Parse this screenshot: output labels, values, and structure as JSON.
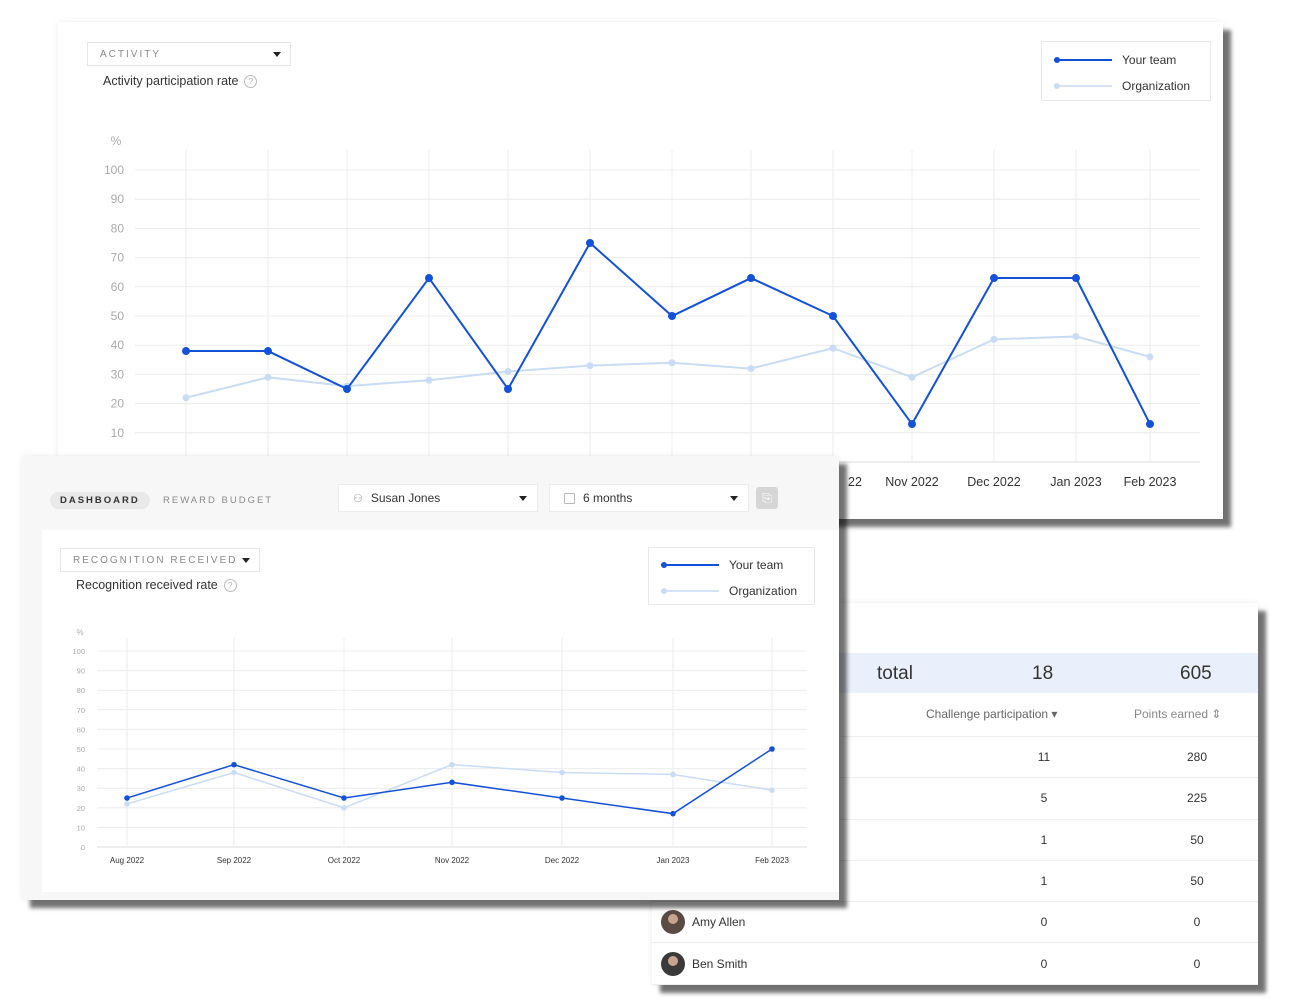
{
  "activity_chart": {
    "dropdown_label": "ACTIVITY",
    "subtitle": "Activity participation rate",
    "help_icon": "?",
    "legend": {
      "team": "Your team",
      "org": "Organization"
    },
    "colors": {
      "team": "#1251d9",
      "org": "#c9dcf5"
    },
    "y_unit": "%",
    "chart_data": {
      "type": "line",
      "y_ticks": [
        "100",
        "90",
        "80",
        "70",
        "60",
        "50",
        "40",
        "30",
        "20",
        "10"
      ],
      "x_labels": [
        "",
        "",
        "",
        "",
        "",
        "",
        "",
        "",
        "Oct 2022",
        "Nov 2022",
        "Dec 2022",
        "Jan 2023",
        "Feb 2023"
      ],
      "x_visible_labels": [
        "22",
        "Nov 2022",
        "Dec 2022",
        "Jan 2023",
        "Feb 2023"
      ],
      "ylim": [
        0,
        100
      ],
      "series": [
        {
          "name": "Your team",
          "values": [
            38,
            38,
            25,
            63,
            25,
            75,
            50,
            63,
            50,
            13,
            63,
            63,
            13
          ]
        },
        {
          "name": "Organization",
          "values": [
            22,
            29,
            26,
            28,
            31,
            33,
            34,
            32,
            39,
            29,
            42,
            43,
            36
          ]
        }
      ]
    }
  },
  "recognition_panel": {
    "tabs": {
      "dashboard": "DASHBOARD",
      "reward_budget": "REWARD BUDGET"
    },
    "person_select": "Susan Jones",
    "period_select": "6 months",
    "dropdown_label": "RECOGNITION RECEIVED",
    "subtitle": "Recognition received rate",
    "help_icon": "?",
    "legend": {
      "team": "Your team",
      "org": "Organization"
    },
    "y_unit": "%",
    "chart_data": {
      "type": "line",
      "y_ticks": [
        "100",
        "90",
        "80",
        "70",
        "60",
        "50",
        "40",
        "30",
        "20",
        "10",
        "0"
      ],
      "categories": [
        "Aug 2022",
        "Sep 2022",
        "Oct 2022",
        "Nov 2022",
        "Dec 2022",
        "Jan 2023",
        "Feb 2023"
      ],
      "ylim": [
        0,
        100
      ],
      "series": [
        {
          "name": "Your team",
          "values": [
            25,
            42,
            25,
            33,
            25,
            17,
            50
          ]
        },
        {
          "name": "Organization",
          "values": [
            22,
            38,
            20,
            42,
            38,
            37,
            29
          ]
        }
      ]
    }
  },
  "leaderboard": {
    "total_label": "total",
    "total_participation": "18",
    "total_points": "605",
    "headers": {
      "participation": "Challenge participation ▾",
      "points": "Points earned ⇕"
    },
    "rows": [
      {
        "name": "",
        "participation": "11",
        "points": "280"
      },
      {
        "name": "",
        "participation": "5",
        "points": "225"
      },
      {
        "name": "",
        "participation": "1",
        "points": "50"
      },
      {
        "name": "",
        "participation": "1",
        "points": "50"
      },
      {
        "name": "Amy Allen",
        "participation": "0",
        "points": "0"
      },
      {
        "name": "Ben Smith",
        "participation": "0",
        "points": "0"
      }
    ]
  }
}
